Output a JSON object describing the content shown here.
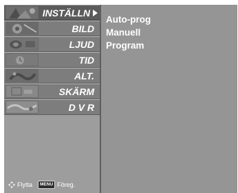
{
  "menu": {
    "items": [
      {
        "label": "INSTÄLLN",
        "icon": "setup-thumbnail-icon",
        "selected": true
      },
      {
        "label": "BILD",
        "icon": "picture-thumbnail-icon",
        "selected": false
      },
      {
        "label": "LJUD",
        "icon": "audio-thumbnail-icon",
        "selected": false
      },
      {
        "label": "TID",
        "icon": "time-thumbnail-icon",
        "selected": false
      },
      {
        "label": "ALT.",
        "icon": "option-thumbnail-icon",
        "selected": false
      },
      {
        "label": "SKÄRM",
        "icon": "screen-thumbnail-icon",
        "selected": false
      },
      {
        "label": "D V R",
        "icon": "dvr-thumbnail-icon",
        "selected": false
      }
    ]
  },
  "submenu": {
    "items": [
      "Auto-prog",
      "Manuell",
      "Program"
    ]
  },
  "footer": {
    "move_label": "Flytta",
    "menu_key": "MENU",
    "prev_label": "Föreg."
  },
  "colors": {
    "panel_bg": "#959595",
    "item_bg": "#7d7d7d",
    "selected_bg": "#5b5b5b",
    "text": "#ffffff"
  }
}
